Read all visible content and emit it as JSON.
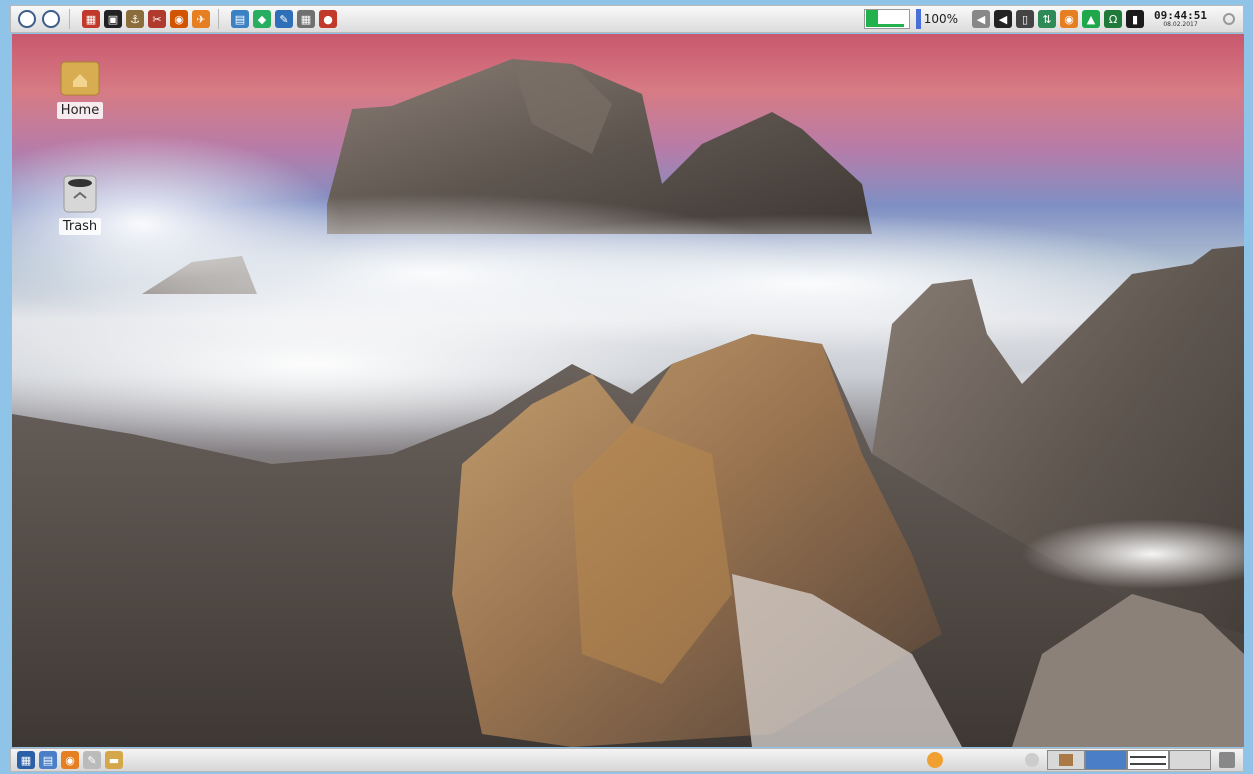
{
  "top_panel": {
    "launchers_left": [
      {
        "icon": "circle-menu-icon"
      },
      {
        "icon": "circle-menu-icon"
      }
    ],
    "launchers_apps": [
      {
        "icon": "app-red-icon",
        "color": "#c0392b",
        "glyph": "▦"
      },
      {
        "icon": "terminal-icon",
        "color": "#222222",
        "glyph": "▣"
      },
      {
        "icon": "anchor-tool-icon",
        "color": "#8a6d3b",
        "glyph": "⚓"
      },
      {
        "icon": "scissors-tool-icon",
        "color": "#b03a2e",
        "glyph": "✂"
      },
      {
        "icon": "globe-app-icon",
        "color": "#d35400",
        "glyph": "◉"
      },
      {
        "icon": "bird-app-icon",
        "color": "#e67e22",
        "glyph": "✈"
      }
    ],
    "launchers_files": [
      {
        "icon": "folder-blue-icon",
        "color": "#3b82c4",
        "glyph": "▤"
      },
      {
        "icon": "color-picker-icon",
        "color": "#27ae60",
        "glyph": "◆"
      },
      {
        "icon": "editor-icon",
        "color": "#2e6fb8",
        "glyph": "✎"
      },
      {
        "icon": "calculator-icon",
        "color": "#707070",
        "glyph": "▦"
      },
      {
        "icon": "tomato-app-icon",
        "color": "#c0392b",
        "glyph": "●"
      }
    ],
    "battery_percent": "100%",
    "tray_icons": [
      {
        "icon": "volume-low-icon",
        "color": "#888888",
        "glyph": "◀"
      },
      {
        "icon": "volume-high-icon",
        "color": "#222222",
        "glyph": "◀"
      },
      {
        "icon": "clipboard-icon",
        "color": "#444444",
        "glyph": "▯"
      },
      {
        "icon": "network-icon",
        "color": "#2e8b57",
        "glyph": "⇅"
      },
      {
        "icon": "browser-tray-icon",
        "color": "#e67e22",
        "glyph": "◉"
      },
      {
        "icon": "lock-icon",
        "color": "#1fa84b",
        "glyph": "▲"
      },
      {
        "icon": "omega-icon",
        "color": "#1f7a3a",
        "glyph": "Ω"
      },
      {
        "icon": "display-icon",
        "color": "#1b1b1b",
        "glyph": "▮"
      }
    ],
    "clock_time": "09:44:51",
    "clock_date": "08.02.2017"
  },
  "desktop": {
    "icons": [
      {
        "label": "Home",
        "icon": "home-folder-icon",
        "color": "#d4a84a"
      },
      {
        "label": "Trash",
        "icon": "trash-icon",
        "color": "#c9c9c9"
      }
    ]
  },
  "bottom_panel": {
    "left_icons": [
      {
        "icon": "app-menu-icon",
        "color": "#2b5fa8",
        "glyph": "▦"
      },
      {
        "icon": "file-manager-icon",
        "color": "#4a7fc8",
        "glyph": "▤"
      },
      {
        "icon": "browser-icon",
        "color": "#e67e22",
        "glyph": "◉"
      },
      {
        "icon": "pen-icon",
        "color": "#bbbbbb",
        "glyph": "✎"
      },
      {
        "icon": "folder-icon",
        "color": "#d4a84a",
        "glyph": "▬"
      }
    ]
  }
}
